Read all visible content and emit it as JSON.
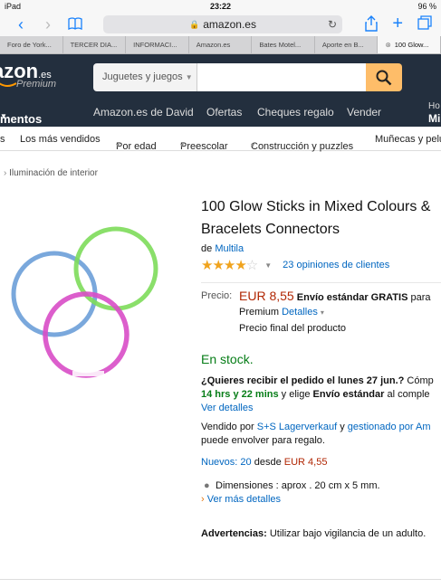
{
  "status": {
    "device": "iPad",
    "time": "23:22",
    "battery": "96 %"
  },
  "browser": {
    "url": "amazon.es",
    "tabs": [
      "Foro de York...",
      "TERCER DIA...",
      "INFORMACI...",
      "Amazon.es",
      "Bates Motel...",
      "Aporte en B...",
      "100 Glow..."
    ]
  },
  "header": {
    "logo": "azon",
    "logo_suffix": ".es",
    "premium": "Premium",
    "search_category": "Juguetes y juegos"
  },
  "nav": {
    "items": [
      "mentos",
      "Amazon.es de David",
      "Ofertas",
      "Cheques regalo",
      "Vender"
    ],
    "right1": "Ho",
    "right2": "Mi"
  },
  "subnav": {
    "items": [
      "s",
      "Los más vendidos",
      "Por edad",
      "Preescolar",
      "Construcción y puzzles",
      "Muñecas y pelu"
    ]
  },
  "breadcrumb": "Iluminación de interior",
  "product": {
    "title_line1": "100 Glow Sticks in Mixed Colours &",
    "title_line2": "Bracelets Connectors",
    "by": "de",
    "brand": "Multila",
    "reviews": "23 opiniones de clientes",
    "price_label": "Precio:",
    "price": "EUR 8,55",
    "shipping": "Envío estándar GRATIS",
    "shipping_tail": "para",
    "premium": "Premium",
    "details": "Detalles",
    "final_price": "Precio final del producto",
    "stock": "En stock.",
    "delivery_q": "¿Quieres recibir el pedido el lunes 27 jun.?",
    "delivery_q_tail": "Cómp",
    "delivery_time": "14 hrs y 22 mins",
    "delivery_mid": "y elige",
    "delivery_std": "Envío estándar",
    "delivery_tail": "al comple",
    "ver_detalles": "Ver detalles",
    "sold_by": "Vendido por",
    "seller": "S+S Lagerverkauf",
    "managed_y": "y",
    "managed": "gestionado por Am",
    "gift": "puede envolver para regalo.",
    "new_label": "Nuevos: 20",
    "new_from": "desde",
    "new_price": "EUR 4,55",
    "dimensions": "Dimensiones : aprox . 20 cm x 5 mm.",
    "more_details": "Ver más detalles",
    "warning_label": "Advertencias:",
    "warning": "Utilizar bajo vigilancia de un adulto.",
    "rating_stars": 4
  }
}
